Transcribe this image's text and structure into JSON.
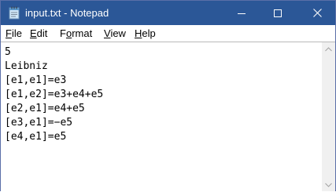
{
  "window": {
    "title": "input.txt - Notepad",
    "titlebar_color": "#2b5797"
  },
  "menu": {
    "items": [
      {
        "accel": "F",
        "rest": "ile"
      },
      {
        "accel": "E",
        "rest": "dit"
      },
      {
        "pre": "F",
        "accel": "o",
        "rest": "rmat"
      },
      {
        "accel": "V",
        "rest": "iew"
      },
      {
        "accel": "H",
        "rest": "elp"
      }
    ]
  },
  "editor": {
    "lines": [
      "5",
      "Leibniz",
      "[e1,e1]=e3",
      "[e1,e2]=e3+e4+e5",
      "[e2,e1]=e4+e5",
      "[e3,e1]=−e5",
      "[e4,e1]=e5"
    ]
  },
  "icons": {
    "app": "notepad-icon",
    "minimize": "minimize-icon",
    "maximize": "maximize-icon",
    "close": "close-icon",
    "scroll_up": "chevron-up-icon",
    "scroll_down": "chevron-down-icon"
  }
}
